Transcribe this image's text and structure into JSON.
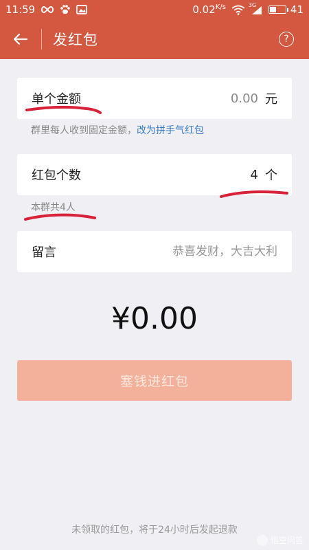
{
  "status_bar": {
    "time": "11:59",
    "net_speed": "0.02",
    "speed_unit": "K/s",
    "signal_label": "3G",
    "battery": "41",
    "battery_level": 0.41
  },
  "header": {
    "title": "发红包"
  },
  "amount_card": {
    "label": "单个金额",
    "value": "0.00",
    "unit": "元"
  },
  "amount_hint": {
    "text": "群里每人收到固定金额，",
    "link": "改为拼手气红包"
  },
  "count_card": {
    "label": "红包个数",
    "value": "4",
    "unit": "个"
  },
  "count_hint": {
    "text": "本群共4人"
  },
  "message_card": {
    "label": "留言",
    "placeholder": "恭喜发财，大吉大利"
  },
  "total": "¥0.00",
  "submit_label": "塞钱进红包",
  "footer_note": "未领取的红包，将于24小时后发起退款",
  "watermark": "悟空问答",
  "colors": {
    "header": "#d4583f",
    "button_disabled": "#f3b19c",
    "link": "#3c7bc7",
    "annotation": "#d7223a"
  }
}
